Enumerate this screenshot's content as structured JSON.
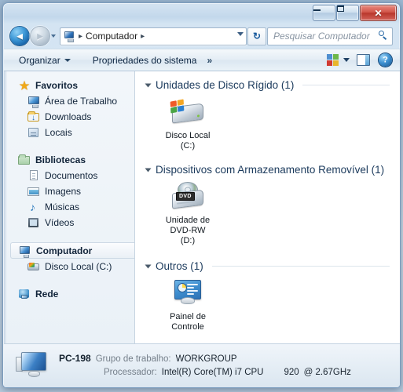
{
  "window": {
    "title": "Computador",
    "controls": {
      "minimize": "Minimizar",
      "maximize": "Maximizar",
      "close": "Fechar",
      "close_glyph": "✕"
    }
  },
  "navbar": {
    "back_label": "Voltar",
    "back_glyph": "◄",
    "forward_label": "Avançar",
    "forward_glyph": "►",
    "history_label": "Páginas recentes",
    "breadcrumb": {
      "icon": "computer-icon",
      "separator": "▸",
      "path": "Computador",
      "trailing_separator": "▸"
    },
    "refresh_label": "Atualizar",
    "refresh_glyph": "↻",
    "search": {
      "placeholder": "Pesquisar Computador",
      "value": ""
    }
  },
  "toolbar": {
    "organize_label": "Organizar",
    "system_properties_label": "Propriedades do sistema",
    "overflow_label": "»",
    "view_label": "Alterar sua exibição",
    "preview_pane_label": "Mostrar o painel de visualização",
    "help_label": "Obter ajuda"
  },
  "sidebar": {
    "groups": [
      {
        "name": "Favoritos",
        "icon": "star-icon",
        "items": [
          {
            "label": "Área de Trabalho",
            "icon": "desktop-icon"
          },
          {
            "label": "Downloads",
            "icon": "downloads-folder-icon"
          },
          {
            "label": "Locais",
            "icon": "recent-places-icon"
          }
        ]
      },
      {
        "name": "Bibliotecas",
        "icon": "libraries-icon",
        "items": [
          {
            "label": "Documentos",
            "icon": "documents-icon"
          },
          {
            "label": "Imagens",
            "icon": "pictures-icon"
          },
          {
            "label": "Músicas",
            "icon": "music-icon"
          },
          {
            "label": "Vídeos",
            "icon": "videos-icon"
          }
        ]
      },
      {
        "name": "Computador",
        "icon": "computer-icon",
        "selected": true,
        "items": [
          {
            "label": "Disco Local (C:)",
            "icon": "hard-drive-icon"
          }
        ]
      },
      {
        "name": "Rede",
        "icon": "network-icon",
        "items": []
      }
    ]
  },
  "content": {
    "groups": [
      {
        "title": "Unidades de Disco Rígido (1)",
        "expanded": true,
        "items": [
          {
            "label": "Disco Local\n(C:)",
            "icon": "hard-drive-large-icon"
          }
        ]
      },
      {
        "title": "Dispositivos com Armazenamento Removível (1)",
        "expanded": true,
        "items": [
          {
            "label": "Unidade de\nDVD-RW\n(D:)",
            "icon": "dvd-drive-icon",
            "badge": "DVD"
          }
        ]
      },
      {
        "title": "Outros (1)",
        "expanded": true,
        "items": [
          {
            "label": "Painel de\nControle",
            "icon": "control-panel-icon"
          }
        ]
      }
    ]
  },
  "statusbar": {
    "icon": "computer-large-icon",
    "computer_name": "PC-198",
    "workgroup_key": "Grupo de trabalho:",
    "workgroup_value": "WORKGROUP",
    "processor_key": "Processador:",
    "processor_value": "Intel(R) Core(TM) i7 CPU",
    "processor_model": "920",
    "processor_speed": "@ 2.67GHz"
  },
  "colors": {
    "accent": "#2d72b5",
    "group_header": "#1b3a5c",
    "close_button": "#b8372c",
    "desktop": "#b9cee0"
  }
}
